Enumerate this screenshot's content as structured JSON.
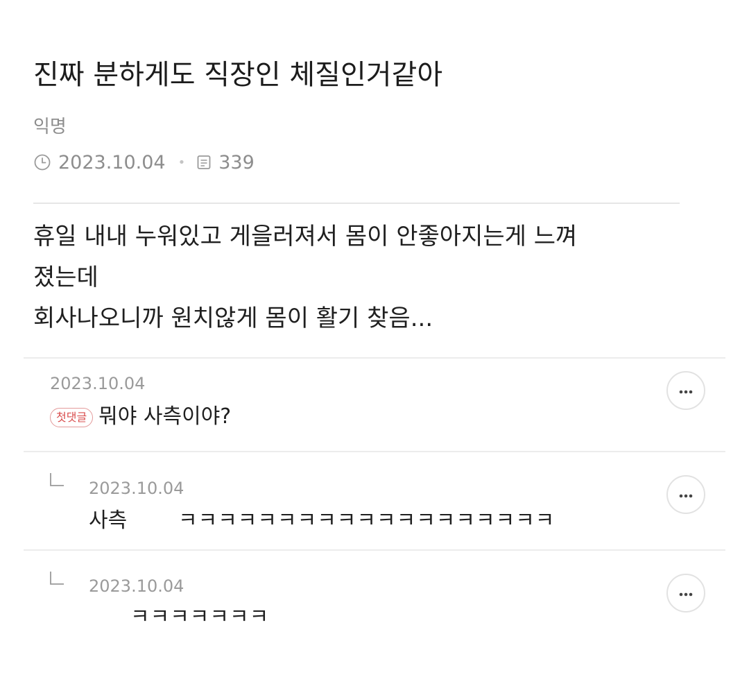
{
  "post": {
    "title": "진짜 분하게도 직장인 체질인거같아",
    "author": "익명",
    "date": "2023.10.04",
    "views": "339",
    "body_lines": [
      "휴일 내내 누워있고 게을러져서 몸이 안좋아지는게 느껴",
      "졌는데",
      "회사나오니까 원치않게 몸이 활기 찾음..."
    ]
  },
  "comments": [
    {
      "date": "2023.10.04",
      "badge": "첫댓글",
      "text": "뭐야 사측이야?"
    },
    {
      "date": "2023.10.04",
      "author": "사측",
      "text": "ㅋㅋㅋㅋㅋㅋㅋㅋㅋㅋㅋㅋㅋㅋㅋㅋㅋㅋㅋ"
    },
    {
      "date": "2023.10.04",
      "text": "ㅋㅋㅋㅋㅋㅋㅋ"
    }
  ],
  "icons": {
    "clock": "clock-icon",
    "views": "document-icon",
    "more": "more-icon",
    "reply": "reply-arrow-icon"
  },
  "colors": {
    "badge": "#d94c4c",
    "meta": "#8d8d8d"
  }
}
